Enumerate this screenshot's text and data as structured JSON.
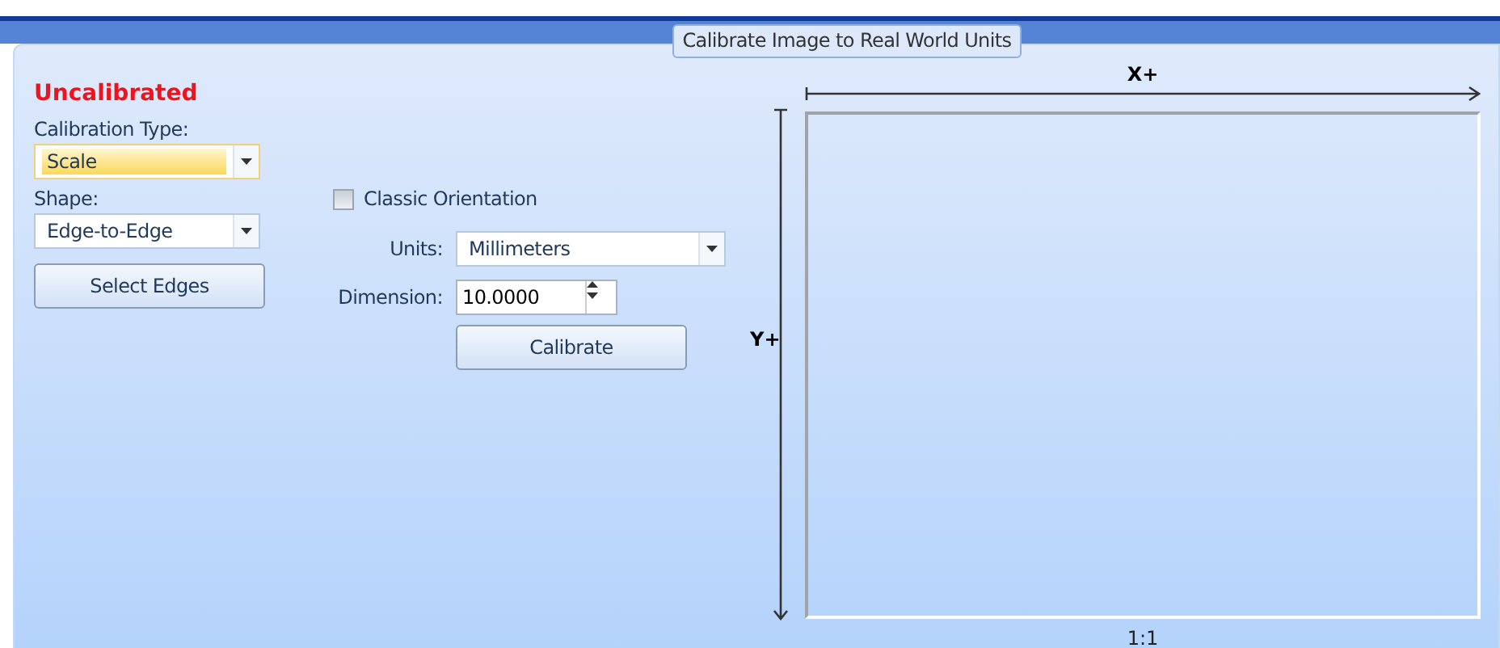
{
  "group_title": "Calibrate Image to Real World Units",
  "status": "Uncalibrated",
  "calibration_type": {
    "label": "Calibration Type:",
    "value": "Scale",
    "focused": true
  },
  "shape": {
    "label": "Shape:",
    "value": "Edge-to-Edge"
  },
  "select_edges_button": "Select Edges",
  "classic_orientation": {
    "label": "Classic Orientation",
    "checked": false
  },
  "units": {
    "label": "Units:",
    "value": "Millimeters"
  },
  "dimension": {
    "label": "Dimension:",
    "value": "10.0000"
  },
  "calibrate_button": "Calibrate",
  "preview": {
    "x_label": "X+",
    "y_label": "Y+",
    "ratio": "1:1"
  }
}
